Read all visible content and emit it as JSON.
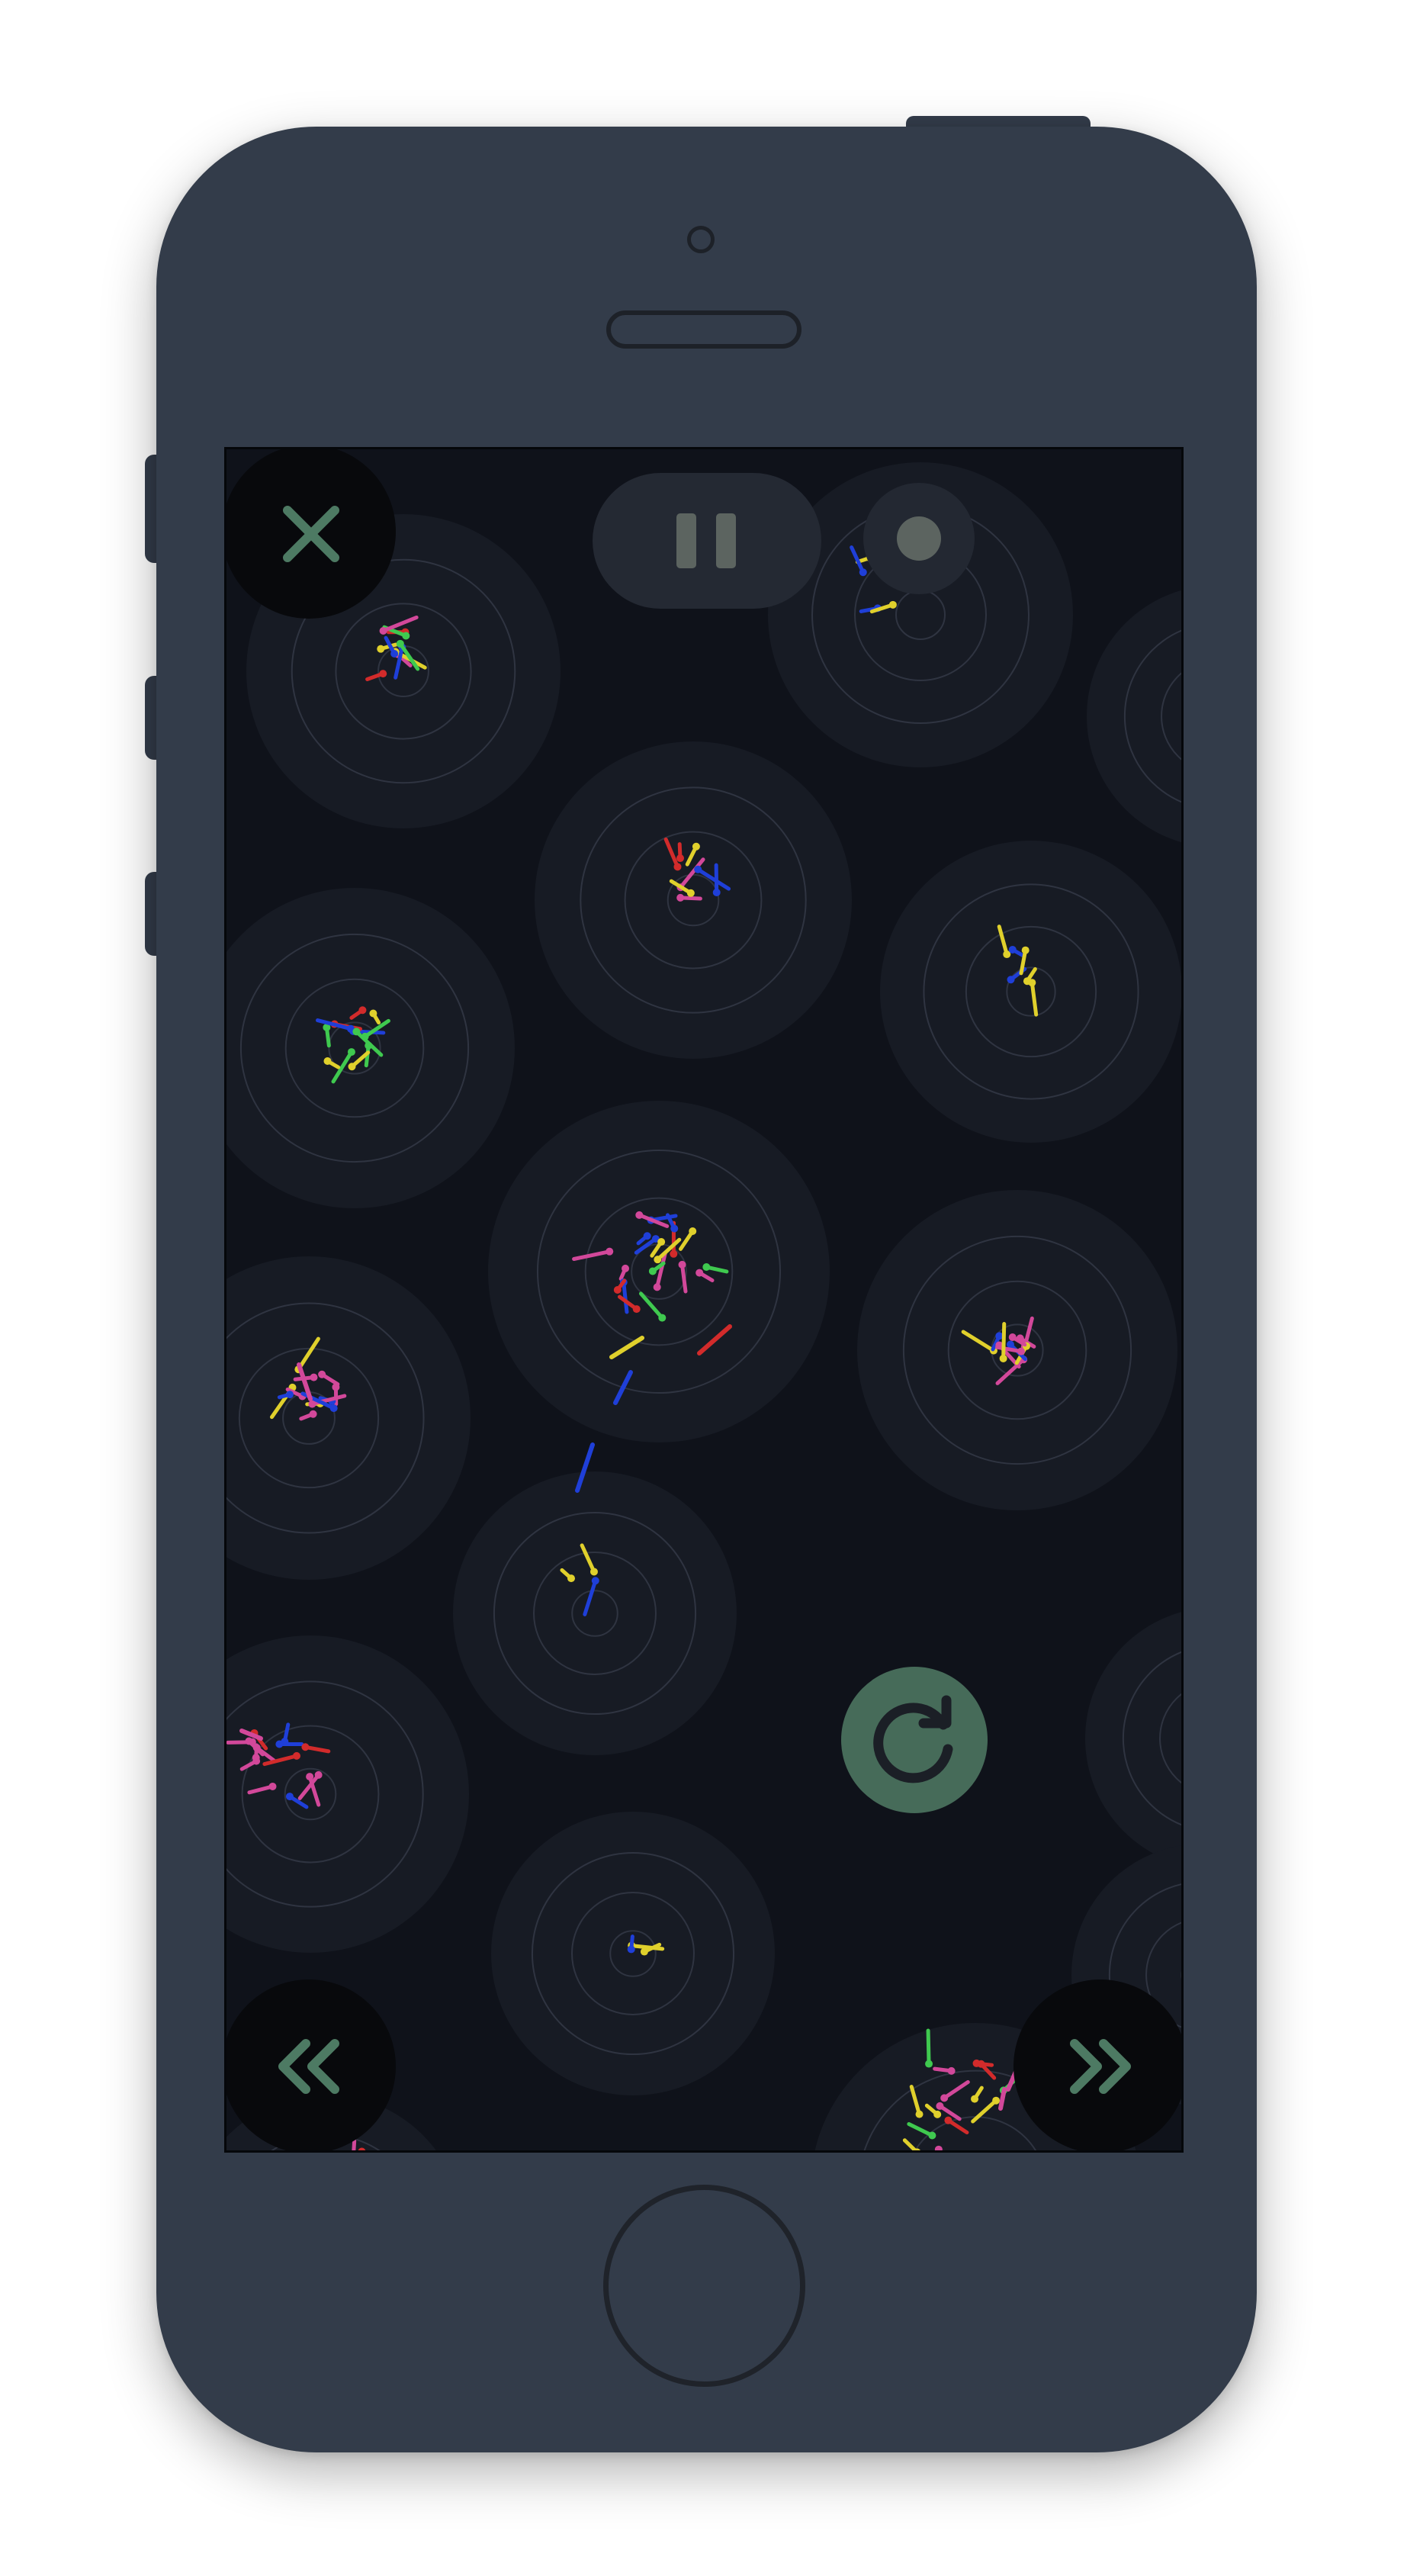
{
  "app": {
    "name": ""
  },
  "colors": {
    "page_bg": "#ffffff",
    "phone_body": "#333c4a",
    "screen_bg": "#0f121a",
    "target_halo": "#171b24",
    "target_ring": "#2f3441",
    "control_dark": "#08090c",
    "control_pill": "#242933",
    "accent_green": "#466b59",
    "icon_green": "#4d7a63",
    "record_dot": "#5c6460",
    "particle_colors": [
      "#d2489a",
      "#e0d02c",
      "#1f3fd8",
      "#d22b2b",
      "#3fc94f"
    ]
  },
  "controls": {
    "close": {
      "icon": "close-x-icon"
    },
    "pause": {
      "icon": "pause-icon"
    },
    "record": {
      "icon": "record-dot-icon"
    },
    "restart": {
      "icon": "restart-arrow-icon"
    },
    "prev": {
      "icon": "double-chevron-left-icon"
    },
    "next": {
      "icon": "double-chevron-right-icon"
    }
  },
  "simulation": {
    "particle_colors_legend": [
      "pink",
      "yellow",
      "blue",
      "red",
      "green"
    ],
    "target_count": 16,
    "rings_per_target": 4
  }
}
